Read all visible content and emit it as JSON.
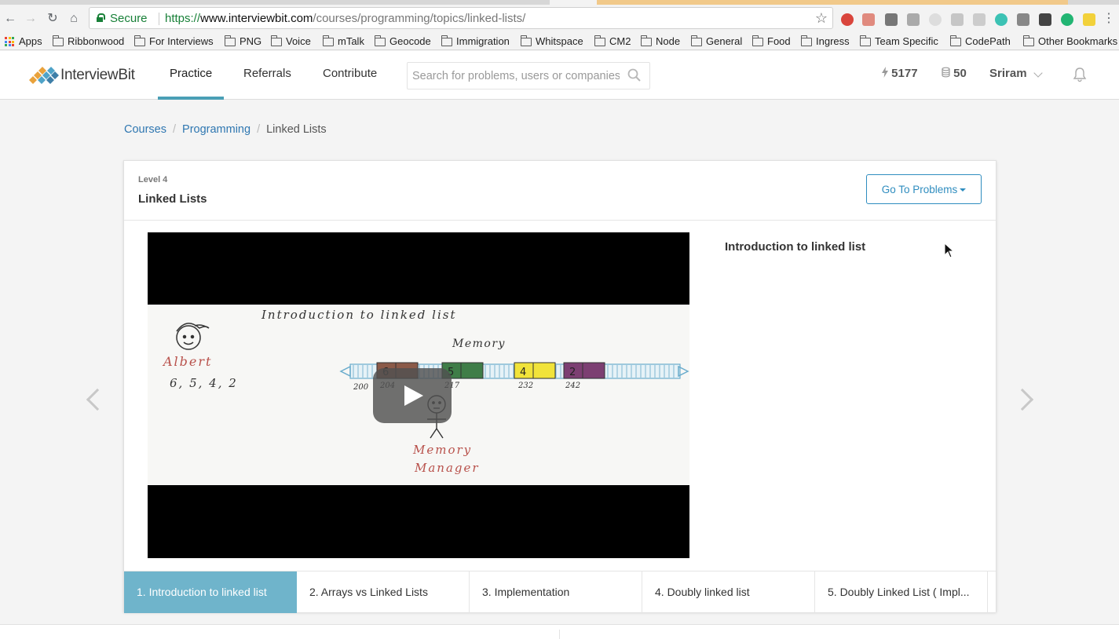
{
  "browser": {
    "secure_label": "Secure",
    "url_scheme": "https://",
    "url_host": "www.interviewbit.com",
    "url_path": "/courses/programming/topics/linked-lists/"
  },
  "bookmarks": [
    "Apps",
    "Ribbonwood",
    "For Interviews",
    "PNG",
    "Voice",
    "mTalk",
    "Geocode",
    "Immigration",
    "Whitspace",
    "CM2",
    "Node",
    "General",
    "Food",
    "Ingress",
    "Team Specific",
    "CodePath",
    "Other Bookmarks"
  ],
  "site": {
    "logo_text": "InterviewBit",
    "nav": [
      "Practice",
      "Referrals",
      "Contribute"
    ],
    "search_placeholder": "Search for problems, users or companies",
    "score": "5177",
    "coins": "50",
    "user": "Sriram"
  },
  "breadcrumb": [
    "Courses",
    "Programming",
    "Linked Lists"
  ],
  "topic": {
    "level": "Level 4",
    "title": "Linked Lists",
    "go_button": "Go To Problems",
    "video_title": "Introduction to linked list"
  },
  "video_frame": {
    "heading": "Introduction to linked list",
    "memory": "Memory",
    "person": "Albert",
    "numbers": "6, 5, 4, 2",
    "manager_line1": "Memory",
    "manager_line2": "Manager",
    "cells": [
      "6",
      "5",
      "4",
      "2"
    ],
    "addresses": [
      "200",
      "204",
      "217",
      "232",
      "242"
    ]
  },
  "course_tabs": [
    "1. Introduction to linked list",
    "2. Arrays vs Linked Lists",
    "3. Implementation",
    "4. Doubly linked list",
    "5. Doubly Linked List ( Impl..."
  ],
  "colors": {
    "accent": "#4a9fb5",
    "active_tab": "#6fb4cb",
    "link": "#2f77b1",
    "button": "#2f8dbf"
  }
}
